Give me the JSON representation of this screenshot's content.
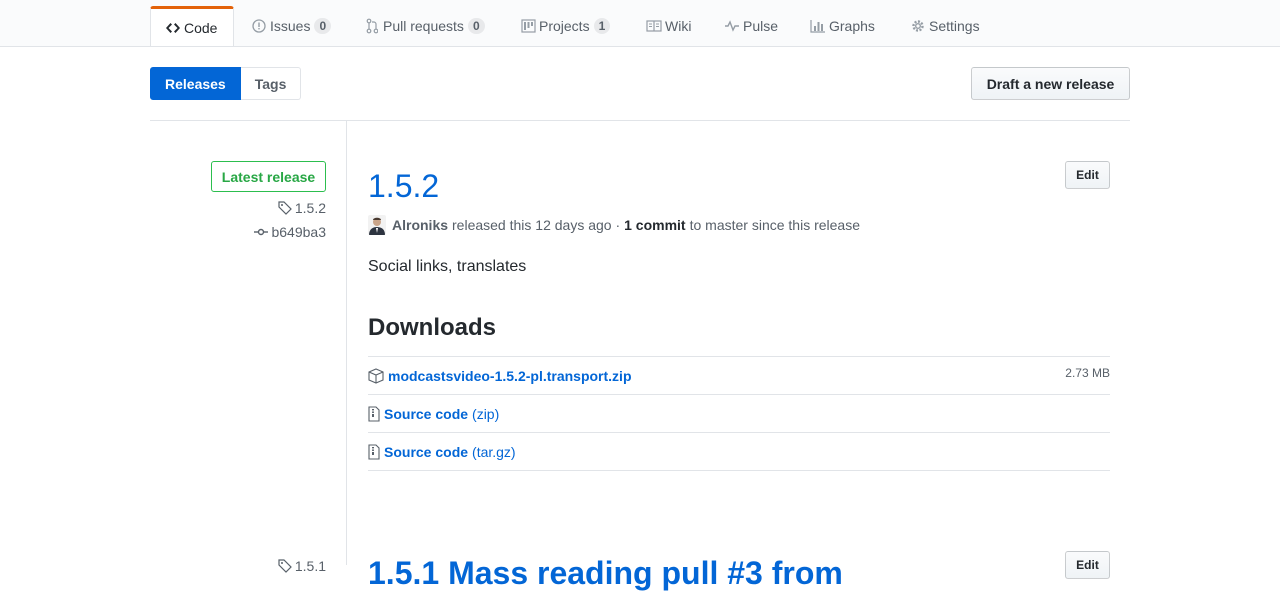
{
  "nav": {
    "code": "Code",
    "issues": "Issues",
    "issues_count": "0",
    "pulls": "Pull requests",
    "pulls_count": "0",
    "projects": "Projects",
    "projects_count": "1",
    "wiki": "Wiki",
    "pulse": "Pulse",
    "graphs": "Graphs",
    "settings": "Settings"
  },
  "subnav": {
    "releases": "Releases",
    "tags": "Tags",
    "draft": "Draft a new release"
  },
  "release": {
    "badge": "Latest release",
    "tag": "1.5.2",
    "commit": "b649ba3",
    "title": "1.5.2",
    "edit": "Edit",
    "author": "Alroniks",
    "released_text": "released this 12 days ago ·",
    "commits": "1 commit",
    "since_text": "to master since this release",
    "description": "Social links, translates",
    "downloads_title": "Downloads",
    "downloads": [
      {
        "name": "modcastsvideo-1.5.2-pl.transport.zip",
        "suffix": "",
        "size": "2.73 MB",
        "icon": "package-icon"
      },
      {
        "name": "Source code",
        "suffix": "(zip)",
        "size": "",
        "icon": "file-zip-icon"
      },
      {
        "name": "Source code",
        "suffix": "(tar.gz)",
        "size": "",
        "icon": "file-zip-icon"
      }
    ]
  },
  "next_release": {
    "tag": "1.5.1",
    "title": "1.5.1 Mass reading pull #3 from",
    "edit": "Edit"
  },
  "colors": {
    "link": "#0366d6",
    "accent_tab": "#e36209",
    "latest_green": "#28a745"
  }
}
